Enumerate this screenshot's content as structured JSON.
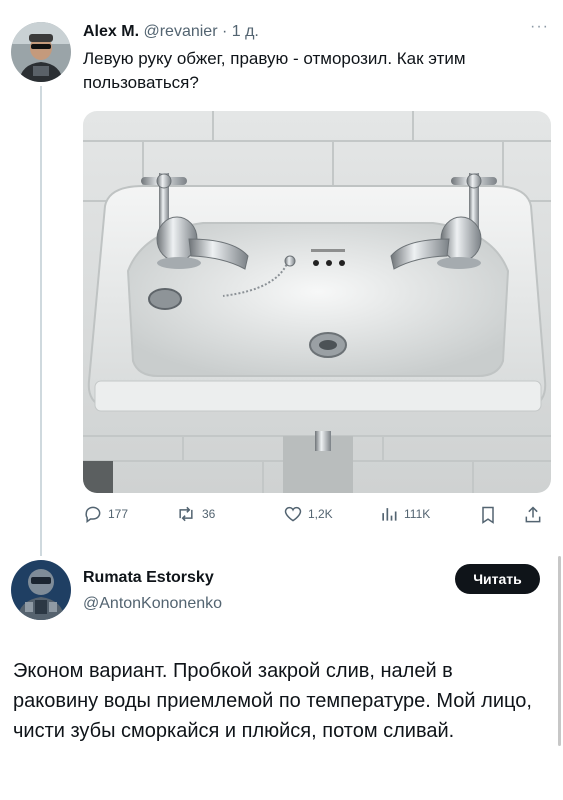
{
  "tweet1": {
    "author_name": "Alex M.",
    "handle": "@revanier",
    "separator": "·",
    "time": "1 д.",
    "more": "···",
    "text": "Левую руку обжег, правую - отморозил. Как этим пользоваться?",
    "actions": {
      "replies": "177",
      "retweets": "36",
      "likes": "1,2K",
      "views": "111K"
    }
  },
  "tweet2": {
    "author_name": "Rumata Estorsky",
    "handle": "@AntonKononenko",
    "follow_label": "Читать",
    "text": "Эконом вариант. Пробкой закрой слив, налей в раковину воды приемлемой по температуре. Мой лицо, чисти зубы сморкайся и плюйся, потом сливай."
  },
  "icons": [
    "more-icon",
    "reply-icon",
    "retweet-icon",
    "like-icon",
    "views-icon",
    "bookmark-icon",
    "share-icon"
  ],
  "colors": {
    "text": "#0f1419",
    "secondary": "#536471",
    "button_bg": "#0f1419",
    "button_text": "#ffffff"
  }
}
